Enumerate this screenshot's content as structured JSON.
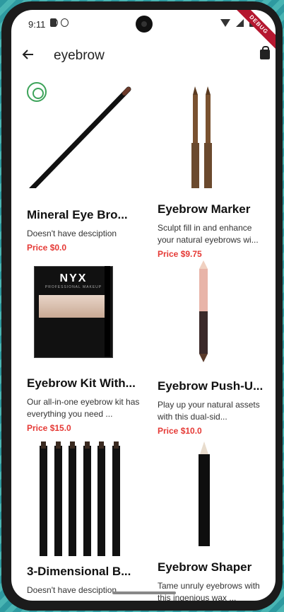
{
  "status_bar": {
    "time": "9:11",
    "debug_label": "DEBUG"
  },
  "app_bar": {
    "title": "eyebrow"
  },
  "products": [
    {
      "name": "Mineral Eye Bro...",
      "desc": "Doesn't have desciption",
      "price": "Price $0.0"
    },
    {
      "name": "Eyebrow Marker",
      "desc": "Sculpt fill in and enhance your natural eyebrows wi...",
      "price": "Price $9.75"
    },
    {
      "name": "Eyebrow Kit With...",
      "desc": "Our all-in-one eyebrow kit has everything you need ...",
      "price": "Price $15.0"
    },
    {
      "name": "Eyebrow Push-U...",
      "desc": "Play up your natural assets with this dual-sid...",
      "price": "Price $10.0"
    },
    {
      "name": "3-Dimensional B...",
      "desc": "Doesn't have desciption",
      "price": ""
    },
    {
      "name": "Eyebrow Shaper",
      "desc": "Tame unruly eyebrows with this ingenious wax ...",
      "price": ""
    }
  ],
  "images": {
    "kit_brand": "NYX",
    "kit_sub": "PROFESSIONAL MAKEUP"
  }
}
